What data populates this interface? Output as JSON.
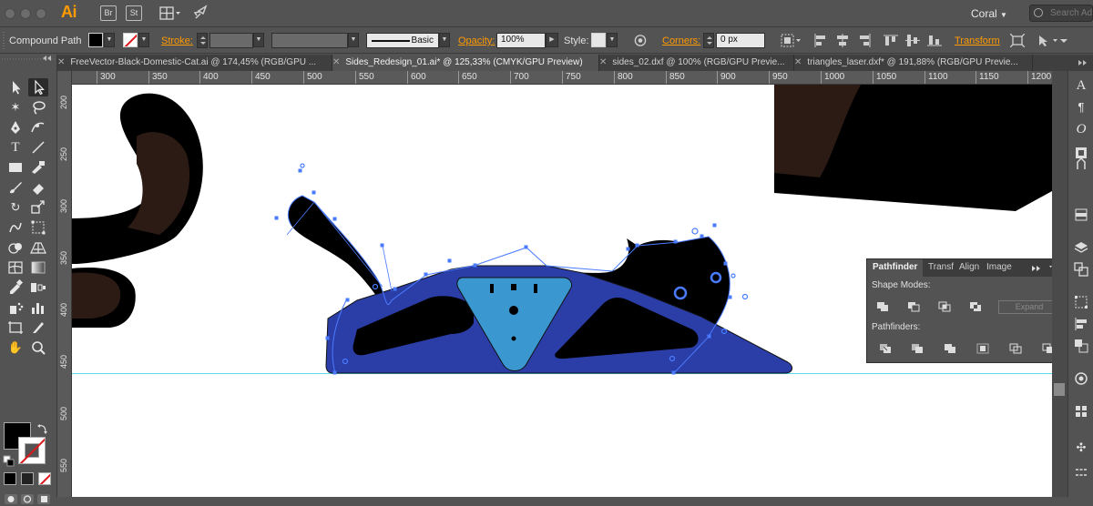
{
  "app": {
    "name": "Ai",
    "bridge_label": "Br",
    "stock_label": "St",
    "workspace": "Coral",
    "search_placeholder": "Search Adobe Stock"
  },
  "control_bar": {
    "selection_type": "Compound Path",
    "stroke_label": "Stroke:",
    "brush_label": "Basic",
    "opacity_label": "Opacity:",
    "opacity_value": "100%",
    "style_label": "Style:",
    "corners_label": "Corners:",
    "corners_value": "0 px",
    "transform_label": "Transform"
  },
  "tabs": [
    {
      "label": "FreeVector-Black-Domestic-Cat.ai @ 174,45% (RGB/GPU ...",
      "active": false
    },
    {
      "label": "Sides_Redesign_01.ai* @ 125,33% (CMYK/GPU Preview)",
      "active": true
    },
    {
      "label": "sides_02.dxf @ 100% (RGB/GPU Previe...",
      "active": false
    },
    {
      "label": "triangles_laser.dxf* @ 191,88% (RGB/GPU Previe...",
      "active": false
    }
  ],
  "ruler": {
    "horizontal": [
      "300",
      "350",
      "400",
      "450",
      "500",
      "550",
      "600",
      "650",
      "700",
      "750",
      "800",
      "850",
      "900",
      "950",
      "1000",
      "1050",
      "1100",
      "1150",
      "1200"
    ],
    "vertical": [
      "200",
      "250",
      "300",
      "350",
      "400",
      "450",
      "500",
      "550"
    ]
  },
  "pathfinder": {
    "tabs": [
      "Pathfinder",
      "Transf",
      "Align",
      "Image"
    ],
    "shape_modes_label": "Shape Modes:",
    "pathfinders_label": "Pathfinders:",
    "expand_label": "Expand"
  },
  "colors": {
    "ui_bg": "#535353",
    "accent_orange": "#ff9a00",
    "frame_blue": "#2b3ea8",
    "triangle_blue": "#3b97d0",
    "selection_blue": "#4a7bff",
    "guide_cyan": "#5fd9e8",
    "cat_brown": "#2c1a14"
  },
  "icons": [
    "search-icon",
    "arrange-documents-icon",
    "gpu-rocket-icon",
    "selection-tool-icon",
    "direct-selection-tool-icon",
    "magic-wand-icon",
    "lasso-icon",
    "pen-icon",
    "curvature-icon",
    "type-icon",
    "line-icon",
    "rectangle-icon",
    "paintbrush-icon",
    "shaper-icon",
    "eraser-icon",
    "rotate-icon",
    "scale-icon",
    "warp-icon",
    "free-transform-icon",
    "shape-builder-icon",
    "perspective-icon",
    "mesh-icon",
    "gradient-icon",
    "eyedropper-icon",
    "blend-icon",
    "symbol-sprayer-icon",
    "graph-icon",
    "artboard-icon",
    "slice-icon",
    "hand-icon",
    "zoom-icon"
  ]
}
